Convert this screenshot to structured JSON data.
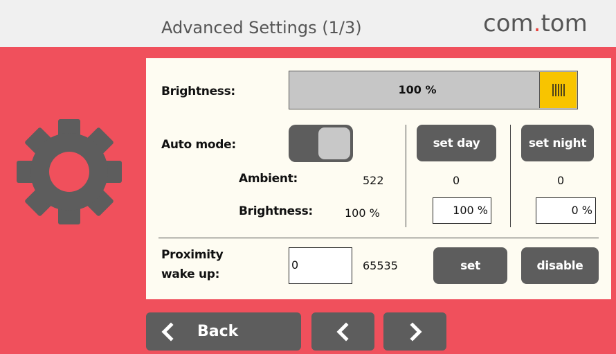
{
  "header": {
    "title": "Advanced Settings (1/3)",
    "brand_prefix": "com",
    "brand_dot": ".",
    "brand_suffix": "tom"
  },
  "sidebar": {
    "icon": "gear-icon"
  },
  "brightness": {
    "label": "Brightness:",
    "value_text": "100 %",
    "level": 1.0
  },
  "auto_mode": {
    "label": "Auto mode:",
    "enabled": true,
    "set_day_label": "set day",
    "set_night_label": "set night"
  },
  "ambient": {
    "label": "Ambient:",
    "current": "522",
    "day": "0",
    "night": "0"
  },
  "brightness_row": {
    "label": "Brightness:",
    "current": "100 %",
    "day_value": "100 %",
    "night_value": "0 %"
  },
  "proximity": {
    "label_line1": "Proximity",
    "label_line2": "wake up:",
    "input_value": "0",
    "reading": "65535",
    "set_label": "set",
    "disable_label": "disable"
  },
  "nav": {
    "back_label": "Back"
  },
  "colors": {
    "accent_red": "#f0505c",
    "slider_knob": "#f8c400",
    "button_gray": "#5d5d5d"
  }
}
